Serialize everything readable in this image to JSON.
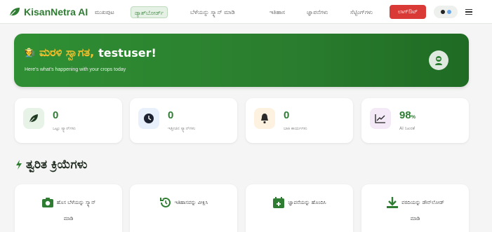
{
  "app": {
    "brand": "KisanNetra AI",
    "colors": {
      "brand": "#2e7d32",
      "accent": "#f5c12e",
      "danger": "#d93a36",
      "background": "#f4f5f4"
    }
  },
  "nav": {
    "items": [
      {
        "label": "ಮುಖಪುಟ",
        "active": false
      },
      {
        "label": "ಡ್ಯಾಶ್‌ಬೋರ್ಡ್",
        "active": true
      },
      {
        "label": "ಬೆಳೆಯನ್ನು ಸ್ಕ್ಯಾನ್ ಮಾಡಿ",
        "active": false
      },
      {
        "label": "ಇತಿಹಾಸ",
        "active": false
      },
      {
        "label": "ಜ್ಞಾಪನೆಗಳು",
        "active": false
      },
      {
        "label": "ಸೆಟ್ಟಿಂಗ್‌ಗಳು",
        "active": false
      }
    ],
    "logout_label": "ಲಾಗ್‌ಔಟ್",
    "lang_toggle_icon": "language-toggle-icon",
    "menu_icon": "hamburger-menu-icon"
  },
  "banner": {
    "greeting": "ಮರಳಿ ಸ್ವಾಗತ,",
    "username": "testuser!",
    "subtitle": "Here's what's happening with your crops today",
    "icon": "robot-avatar-icon"
  },
  "stats": [
    {
      "value": "0",
      "unit": "",
      "label": "ಒಟ್ಟು ಸ್ಕ್ಯಾನ್‌ಗಳು",
      "icon": "leaf-icon",
      "icon_bg": "#e8f3e8"
    },
    {
      "value": "0",
      "unit": "",
      "label": "ಇತ್ತೀಚಿನ ಸ್ಕ್ಯಾನ್‌ಗಳು",
      "icon": "clock-icon",
      "icon_bg": "#e7f0fb"
    },
    {
      "value": "0",
      "unit": "",
      "label": "ಬಾಕಿ ಕಾರ್ಯಗಳು",
      "icon": "bell-icon",
      "icon_bg": "#fdf2e0"
    },
    {
      "value": "98",
      "unit": "%",
      "label": "AI ನಿಖರತೆ",
      "icon": "trend-chart-icon",
      "icon_bg": "#f3e9f7"
    }
  ],
  "quick_actions": {
    "title": "ತ್ವರಿತ ಕ್ರಿಯೆಗಳು",
    "title_icon": "lightning-icon",
    "items": [
      {
        "label": "ಹೊಸ ಬೆಳೆಯನ್ನು ಸ್ಕ್ಯಾನ್",
        "label2": "ಮಾಡಿ",
        "icon": "camera-icon"
      },
      {
        "label": "ಇತಿಹಾಸವನ್ನು ವೀಕ್ಷಿಸಿ",
        "label2": "",
        "icon": "history-icon"
      },
      {
        "label": "ಜ್ಞಾಪನೆಯನ್ನು ಹೊಂದಿಸಿ",
        "label2": "",
        "icon": "calendar-add-icon"
      },
      {
        "label": "ವರದಿಯನ್ನು ಡೌನ್‌ಲೋಡ್",
        "label2": "ಮಾಡಿ",
        "icon": "download-icon"
      }
    ]
  }
}
